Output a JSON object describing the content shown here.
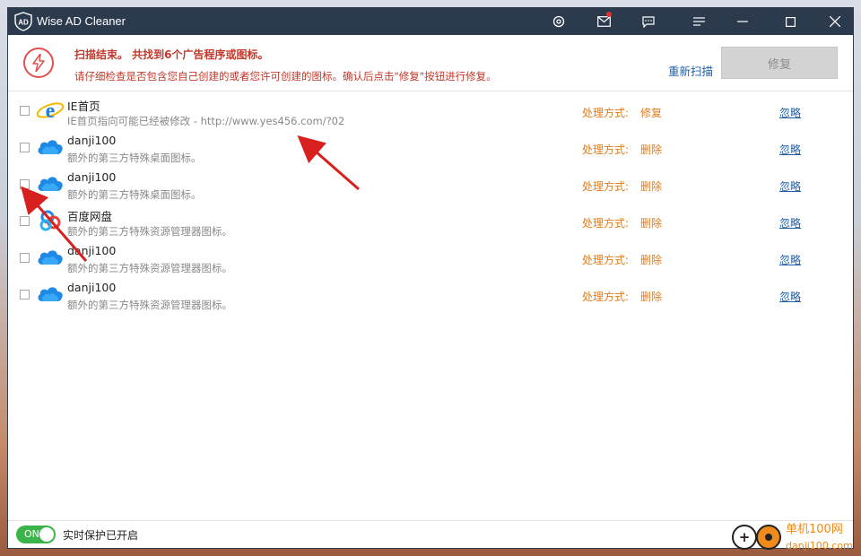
{
  "app": {
    "title": "Wise AD Cleaner",
    "logo_text": "AD"
  },
  "titlebar": {
    "buttons": [
      {
        "name": "settings-icon",
        "label": "settings"
      },
      {
        "name": "mail-icon",
        "label": "messages"
      },
      {
        "name": "feedback-icon",
        "label": "feedback"
      },
      {
        "name": "menu-icon",
        "label": "menu"
      },
      {
        "name": "minimize-icon",
        "label": "minimize"
      },
      {
        "name": "maximize-icon",
        "label": "maximize"
      },
      {
        "name": "close-icon",
        "label": "close"
      }
    ]
  },
  "header": {
    "summary": "扫描结束。 共找到6个广告程序或图标。",
    "hint": "请仔细检查是否包含您自己创建的或者您许可创建的图标。确认后点击\"修复\"按钮进行修复。",
    "rescan_label": "重新扫描",
    "fix_label": "修复"
  },
  "items": [
    {
      "icon": "ie-icon",
      "name": "IE首页",
      "desc": "IE首页指向可能已经被修改 - http://www.yes456.com/?02",
      "action_label": "处理方式:",
      "action": "修复",
      "ignore": "忽略"
    },
    {
      "icon": "cloud-icon",
      "name": "danji100",
      "desc": "额外的第三方特殊桌面图标。",
      "action_label": "处理方式:",
      "action": "删除",
      "ignore": "忽略"
    },
    {
      "icon": "cloud-icon",
      "name": "danji100",
      "desc": "额外的第三方特殊桌面图标。",
      "action_label": "处理方式:",
      "action": "删除",
      "ignore": "忽略"
    },
    {
      "icon": "baidu-netdisk-icon",
      "name": "百度网盘",
      "desc": "额外的第三方特殊资源管理器图标。",
      "action_label": "处理方式:",
      "action": "删除",
      "ignore": "忽略"
    },
    {
      "icon": "cloud-icon",
      "name": "danji100",
      "desc": "额外的第三方特殊资源管理器图标。",
      "action_label": "处理方式:",
      "action": "删除",
      "ignore": "忽略"
    },
    {
      "icon": "cloud-icon",
      "name": "danji100",
      "desc": "额外的第三方特殊资源管理器图标。",
      "action_label": "处理方式:",
      "action": "删除",
      "ignore": "忽略"
    }
  ],
  "footer": {
    "toggle_label": "ON",
    "status": "实时保护已开启"
  },
  "watermark": {
    "text": "单机100网",
    "url": "danji100.com"
  },
  "colors": {
    "titlebar": "#2c3a4e",
    "accent_red": "#c0392b",
    "action_orange": "#e07b1a",
    "link_blue": "#1f5fa8",
    "toggle_green": "#3bb54a"
  }
}
